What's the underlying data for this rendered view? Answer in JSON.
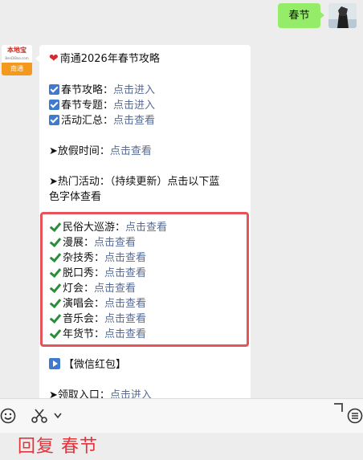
{
  "outgoing": {
    "text": "春节"
  },
  "avatar": {
    "brand": "本地宝",
    "brand_sub": "BenDiBao.com",
    "city": "南通"
  },
  "message": {
    "title": "南通2026年春节攻略",
    "links": [
      {
        "label": "春节攻略：",
        "action": "点击进入"
      },
      {
        "label": "春节专题：",
        "action": "点击进入"
      },
      {
        "label": "活动汇总：",
        "action": "点击查看"
      }
    ],
    "holiday": {
      "label": "➤放假时间：",
      "action": "点击查看"
    },
    "hot": {
      "line1": "➤热门活动：（持续更新）点击以下蓝",
      "line2": "色字体查看"
    },
    "activities": [
      {
        "label": "民俗大巡游：",
        "action": "点击查看"
      },
      {
        "label": "漫展：",
        "action": "点击查看"
      },
      {
        "label": "杂技秀：",
        "action": "点击查看"
      },
      {
        "label": "脱口秀：",
        "action": "点击查看"
      },
      {
        "label": "灯会：",
        "action": "点击查看"
      },
      {
        "label": "演唱会：",
        "action": "点击查看"
      },
      {
        "label": "音乐会：",
        "action": "点击查看"
      },
      {
        "label": "年货节：",
        "action": "点击查看"
      }
    ],
    "hongbao": "【微信红包】",
    "claim": {
      "label": "➤领取入口：",
      "action": "点击进入"
    }
  },
  "toolbar": {
    "emoji_icon": "emoji-icon",
    "scissors_icon": "scissors-icon",
    "menu_icon": "menu-icon"
  },
  "reply": {
    "text": "回复 春节"
  },
  "colors": {
    "link": "#576b95",
    "bubble_out": "#95ec69",
    "highlight_border": "#e6545a",
    "reply_text": "#e2343b"
  }
}
